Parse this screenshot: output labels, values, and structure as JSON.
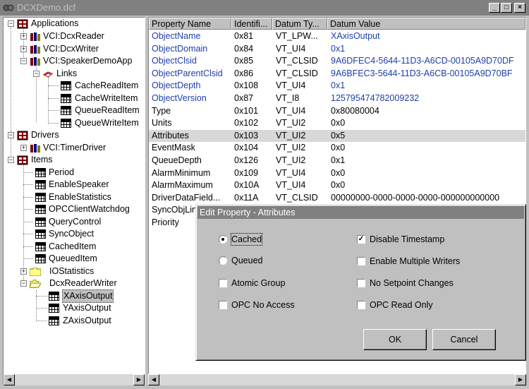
{
  "window": {
    "title": "DCXDemo.dcf",
    "minimize": "_",
    "maximize": "□",
    "close": "×"
  },
  "tree": {
    "items": [
      {
        "label": "Applications",
        "icon": "application-group-icon"
      },
      {
        "label": "VCI:DcxReader",
        "icon": "app-module-icon"
      },
      {
        "label": "VCI:DcxWriter",
        "icon": "app-module-icon"
      },
      {
        "label": "VCI:SpeakerDemoApp",
        "icon": "app-module-icon"
      },
      {
        "label": "Links",
        "icon": "links-icon"
      },
      {
        "label": "CacheReadItem",
        "icon": "grid-item-icon"
      },
      {
        "label": "CacheWriteItem",
        "icon": "grid-item-icon"
      },
      {
        "label": "QueueReadItem",
        "icon": "grid-item-icon"
      },
      {
        "label": "QueueWriteItem",
        "icon": "grid-item-icon"
      },
      {
        "label": "Drivers",
        "icon": "driver-group-icon"
      },
      {
        "label": "VCI:TimerDriver",
        "icon": "app-module-icon"
      },
      {
        "label": "Items",
        "icon": "items-group-icon"
      },
      {
        "label": "Period",
        "icon": "grid-item-icon"
      },
      {
        "label": "EnableSpeaker",
        "icon": "grid-item-icon"
      },
      {
        "label": "EnableStatistics",
        "icon": "grid-item-icon"
      },
      {
        "label": "OPCClientWatchdog",
        "icon": "grid-item-icon"
      },
      {
        "label": "QueryControl",
        "icon": "grid-item-icon"
      },
      {
        "label": "SyncObject",
        "icon": "grid-item-icon"
      },
      {
        "label": "CachedItem",
        "icon": "grid-item-icon"
      },
      {
        "label": "QueuedItem",
        "icon": "grid-item-icon"
      },
      {
        "label": "IOStatistics",
        "icon": "folder-icon"
      },
      {
        "label": "DcxReaderWriter",
        "icon": "folder-open-icon"
      },
      {
        "label": "XAxisOutput",
        "icon": "grid-item-icon"
      },
      {
        "label": "YAxisOutput",
        "icon": "grid-item-icon"
      },
      {
        "label": "ZAxisOutput",
        "icon": "grid-item-icon"
      }
    ]
  },
  "list": {
    "headers": [
      "Property Name",
      "Identifi...",
      "Datum Ty...",
      "Datum Value"
    ],
    "rows": [
      [
        "ObjectName",
        "0x81",
        "VT_LPW...",
        "XAxisOutput"
      ],
      [
        "ObjectDomain",
        "0x84",
        "VT_UI4",
        "0x1"
      ],
      [
        "ObjectClsid",
        "0x85",
        "VT_CLSID",
        "9A6DFEC4-5644-11D3-A6CD-00105A9D70DF"
      ],
      [
        "ObjectParentClsid",
        "0x86",
        "VT_CLSID",
        "9A6BFEC3-5644-11D3-A6CB-00105A9D70BF"
      ],
      [
        "ObjectDepth",
        "0x108",
        "VT_UI4",
        "0x1"
      ],
      [
        "ObjectVersion",
        "0x87",
        "VT_I8",
        "125795474782009232"
      ],
      [
        "Type",
        "0x101",
        "VT_UI4",
        "0x80080004"
      ],
      [
        "Units",
        "0x102",
        "VT_UI2",
        "0x0"
      ],
      [
        "Attributes",
        "0x103",
        "VT_UI2",
        "0x5"
      ],
      [
        "EventMask",
        "0x104",
        "VT_UI2",
        "0x0"
      ],
      [
        "QueueDepth",
        "0x126",
        "VT_UI2",
        "0x1"
      ],
      [
        "AlarmMinimum",
        "0x109",
        "VT_UI4",
        "0x0"
      ],
      [
        "AlarmMaximum",
        "0x10A",
        "VT_UI4",
        "0x0"
      ],
      [
        "DriverDataField...",
        "0x11A",
        "VT_CLSID",
        "00000000-0000-0000-0000-000000000000"
      ],
      [
        "SyncObjLin",
        "",
        "",
        ""
      ],
      [
        "Priority",
        "",
        "",
        ""
      ]
    ],
    "highlighted_row": 8
  },
  "dialog": {
    "title": "Edit Property - Attributes",
    "options": {
      "cached": {
        "label": "Cached",
        "checked": true
      },
      "queued": {
        "label": "Queued",
        "checked": false
      },
      "atomic_group": {
        "label": "Atomic Group",
        "checked": false
      },
      "opc_no_access": {
        "label": "OPC No Access",
        "checked": false
      },
      "disable_timestamp": {
        "label": "Disable Timestamp",
        "checked": true
      },
      "enable_multiple_writers": {
        "label": "Enable Multiple Writers",
        "checked": false
      },
      "no_setpoint_changes": {
        "label": "No Setpoint Changes",
        "checked": false
      },
      "opc_read_only": {
        "label": "OPC Read Only",
        "checked": false
      }
    },
    "ok_label": "OK",
    "cancel_label": "Cancel"
  }
}
